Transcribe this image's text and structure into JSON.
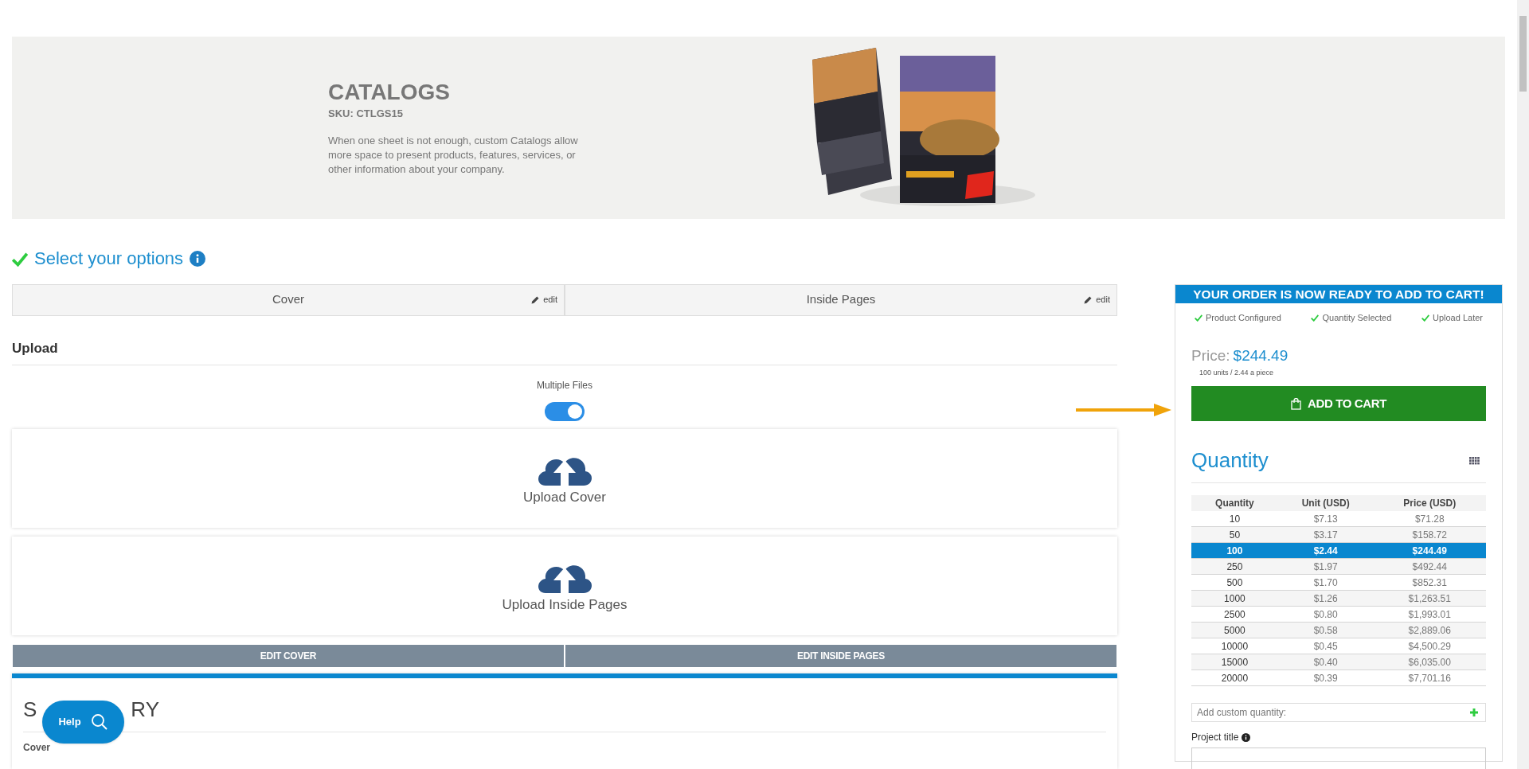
{
  "product": {
    "title": "CATALOGS",
    "sku": "SKU: CTLGS15",
    "description": "When one sheet is not enough, custom Catalogs allow more space to present products, features, services, or other information about your company."
  },
  "options_heading": "Select your options",
  "option_tabs": [
    {
      "label": "Cover",
      "edit": "edit"
    },
    {
      "label": "Inside Pages",
      "edit": "edit"
    }
  ],
  "upload": {
    "title": "Upload",
    "multiple_files_label": "Multiple Files",
    "multiple_files_on": true,
    "areas": [
      "Upload Cover",
      "Upload Inside Pages"
    ],
    "edit_buttons": [
      "EDIT COVER",
      "EDIT INSIDE PAGES"
    ]
  },
  "summary": {
    "title_parts": [
      "S",
      "RY"
    ],
    "sections": [
      "Cover"
    ]
  },
  "help_button": "Help",
  "order": {
    "banner": "YOUR ORDER IS NOW READY TO ADD TO CART!",
    "checks": [
      "Product Configured",
      "Quantity Selected",
      "Upload Later"
    ],
    "price_label": "Price:",
    "price": "$244.49",
    "price_note": "100 units / 2.44 a piece",
    "add_to_cart": "ADD TO CART"
  },
  "quantity": {
    "title": "Quantity",
    "columns": [
      "Quantity",
      "Unit (USD)",
      "Price (USD)"
    ],
    "rows": [
      {
        "cells": [
          "10",
          "$7.13",
          "$71.28"
        ],
        "selected": false
      },
      {
        "cells": [
          "50",
          "$3.17",
          "$158.72"
        ],
        "selected": false
      },
      {
        "cells": [
          "100",
          "$2.44",
          "$244.49"
        ],
        "selected": true
      },
      {
        "cells": [
          "250",
          "$1.97",
          "$492.44"
        ],
        "selected": false
      },
      {
        "cells": [
          "500",
          "$1.70",
          "$852.31"
        ],
        "selected": false
      },
      {
        "cells": [
          "1000",
          "$1.26",
          "$1,263.51"
        ],
        "selected": false
      },
      {
        "cells": [
          "2500",
          "$0.80",
          "$1,993.01"
        ],
        "selected": false
      },
      {
        "cells": [
          "5000",
          "$0.58",
          "$2,889.06"
        ],
        "selected": false
      },
      {
        "cells": [
          "10000",
          "$0.45",
          "$4,500.29"
        ],
        "selected": false
      },
      {
        "cells": [
          "15000",
          "$0.40",
          "$6,035.00"
        ],
        "selected": false
      },
      {
        "cells": [
          "20000",
          "$0.39",
          "$7,701.16"
        ],
        "selected": false
      }
    ],
    "custom_placeholder": "Add custom quantity:",
    "project_title_label": "Project title"
  }
}
